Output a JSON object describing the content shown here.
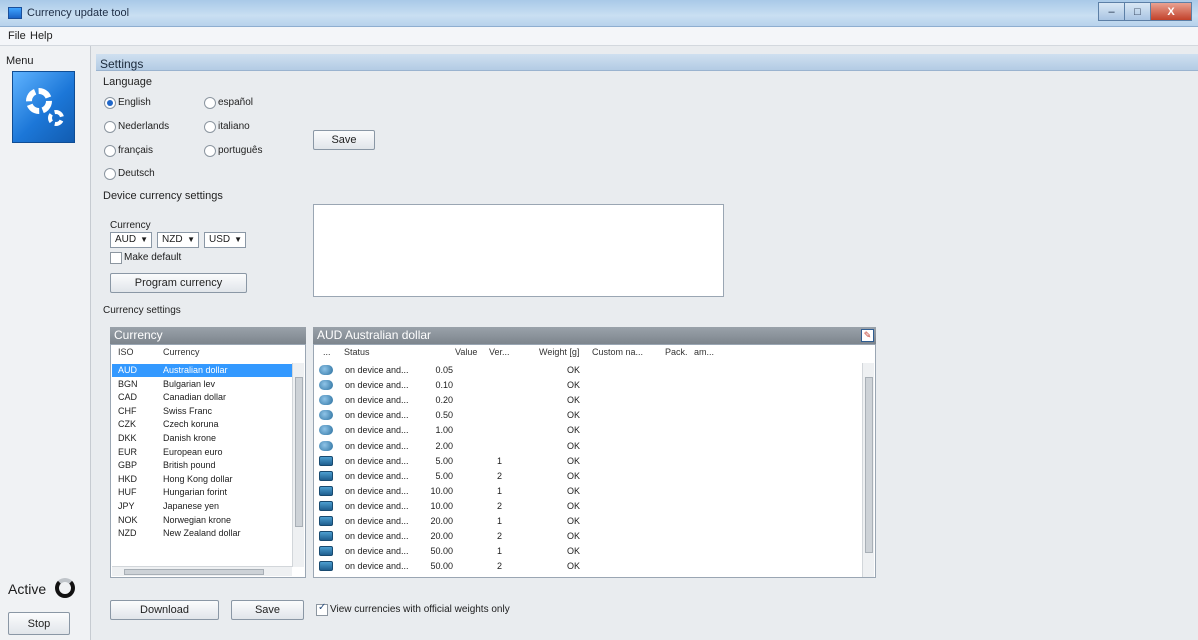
{
  "window": {
    "title": "Currency update tool",
    "min_glyph": "–",
    "max_glyph": "□",
    "close_glyph": "X"
  },
  "menubar": {
    "file": "File",
    "help": "Help"
  },
  "sidebar": {
    "menu_label": "Menu",
    "active_label": "Active",
    "stop_label": "Stop"
  },
  "settings": {
    "title": "Settings",
    "language_label": "Language",
    "languages": [
      {
        "label": "English",
        "checked": true
      },
      {
        "label": "español",
        "checked": false
      },
      {
        "label": "Nederlands",
        "checked": false
      },
      {
        "label": "italiano",
        "checked": false
      },
      {
        "label": "français",
        "checked": false
      },
      {
        "label": "português",
        "checked": false
      },
      {
        "label": "Deutsch",
        "checked": false
      }
    ],
    "save_label": "Save",
    "device_currency_label": "Device currency settings",
    "currency_label": "Currency",
    "currency_selects": [
      "AUD",
      "NZD",
      "USD"
    ],
    "dropdown_glyph": "▼",
    "make_default_label": "Make default",
    "make_default_checked": false,
    "program_currency_label": "Program currency",
    "currency_settings_label": "Currency settings"
  },
  "currency_panel": {
    "title": "Currency",
    "columns": [
      "ISO",
      "Currency"
    ],
    "rows": [
      {
        "iso": "AUD",
        "name": "Australian dollar",
        "selected": true
      },
      {
        "iso": "BGN",
        "name": "Bulgarian lev",
        "selected": false
      },
      {
        "iso": "CAD",
        "name": "Canadian dollar",
        "selected": false
      },
      {
        "iso": "CHF",
        "name": "Swiss Franc",
        "selected": false
      },
      {
        "iso": "CZK",
        "name": "Czech koruna",
        "selected": false
      },
      {
        "iso": "DKK",
        "name": "Danish krone",
        "selected": false
      },
      {
        "iso": "EUR",
        "name": "European euro",
        "selected": false
      },
      {
        "iso": "GBP",
        "name": "British pound",
        "selected": false
      },
      {
        "iso": "HKD",
        "name": "Hong Kong dollar",
        "selected": false
      },
      {
        "iso": "HUF",
        "name": "Hungarian forint",
        "selected": false
      },
      {
        "iso": "JPY",
        "name": "Japanese yen",
        "selected": false
      },
      {
        "iso": "NOK",
        "name": "Norwegian krone",
        "selected": false
      },
      {
        "iso": "NZD",
        "name": "New Zealand dollar",
        "selected": false
      }
    ]
  },
  "denomination_panel": {
    "title": "AUD Australian dollar",
    "columns": [
      "...",
      "Status",
      "Value",
      "Ver...",
      "Weight [g]",
      "Custom na...",
      "Pack.",
      "am..."
    ],
    "rows": [
      {
        "kind": "coin",
        "status": "on device and...",
        "value": "0.05",
        "version": "",
        "weight": "OK"
      },
      {
        "kind": "coin",
        "status": "on device and...",
        "value": "0.10",
        "version": "",
        "weight": "OK"
      },
      {
        "kind": "coin",
        "status": "on device and...",
        "value": "0.20",
        "version": "",
        "weight": "OK"
      },
      {
        "kind": "coin",
        "status": "on device and...",
        "value": "0.50",
        "version": "",
        "weight": "OK"
      },
      {
        "kind": "coin",
        "status": "on device and...",
        "value": "1.00",
        "version": "",
        "weight": "OK"
      },
      {
        "kind": "coin",
        "status": "on device and...",
        "value": "2.00",
        "version": "",
        "weight": "OK"
      },
      {
        "kind": "note",
        "status": "on device and...",
        "value": "5.00",
        "version": "1",
        "weight": "OK"
      },
      {
        "kind": "note",
        "status": "on device and...",
        "value": "5.00",
        "version": "2",
        "weight": "OK"
      },
      {
        "kind": "note",
        "status": "on device and...",
        "value": "10.00",
        "version": "1",
        "weight": "OK"
      },
      {
        "kind": "note",
        "status": "on device and...",
        "value": "10.00",
        "version": "2",
        "weight": "OK"
      },
      {
        "kind": "note",
        "status": "on device and...",
        "value": "20.00",
        "version": "1",
        "weight": "OK"
      },
      {
        "kind": "note",
        "status": "on device and...",
        "value": "20.00",
        "version": "2",
        "weight": "OK"
      },
      {
        "kind": "note",
        "status": "on device and...",
        "value": "50.00",
        "version": "1",
        "weight": "OK"
      },
      {
        "kind": "note",
        "status": "on device and...",
        "value": "50.00",
        "version": "2",
        "weight": "OK"
      }
    ]
  },
  "bottom": {
    "download_label": "Download",
    "save_label": "Save",
    "official_only_label": "View currencies with official weights only",
    "official_only_checked": true
  },
  "colors": {
    "selection": "#3399ff",
    "panel_header": "#8a929a",
    "settings_header": "#c2d6ec",
    "tile_blue": "#1c77d8"
  }
}
